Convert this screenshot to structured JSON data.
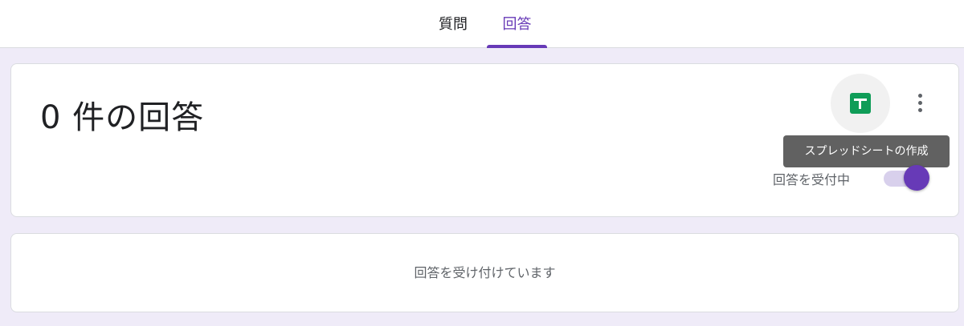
{
  "tabs": {
    "questions": "質問",
    "responses": "回答",
    "active": "responses"
  },
  "summary": {
    "count_label": "0 件の回答",
    "sheets_icon": "google-sheets-icon",
    "more_icon": "more-vert-icon",
    "tooltip": "スプレッドシートの作成",
    "accepting_label": "回答を受付中",
    "accepting_on": true
  },
  "status": {
    "message": "回答を受け付けています"
  },
  "colors": {
    "accent": "#673ab7",
    "sheets_green": "#0f9d58",
    "page_background": "#efebf8"
  }
}
